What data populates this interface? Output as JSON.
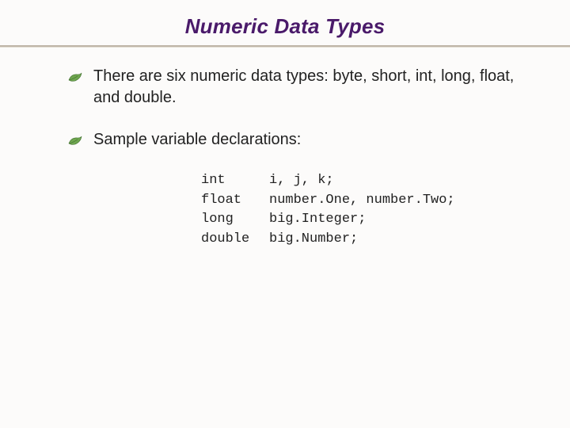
{
  "title": "Numeric Data Types",
  "bullets": [
    "There are six numeric data types: byte, short, int, long, float, and double.",
    "Sample variable declarations:"
  ],
  "code": [
    {
      "type": "int",
      "vars": "i, j, k;"
    },
    {
      "type": "float",
      "vars": "number.One, number.Two;"
    },
    {
      "type": "long",
      "vars": "big.Integer;"
    },
    {
      "type": "double",
      "vars": "big.Number;"
    }
  ]
}
